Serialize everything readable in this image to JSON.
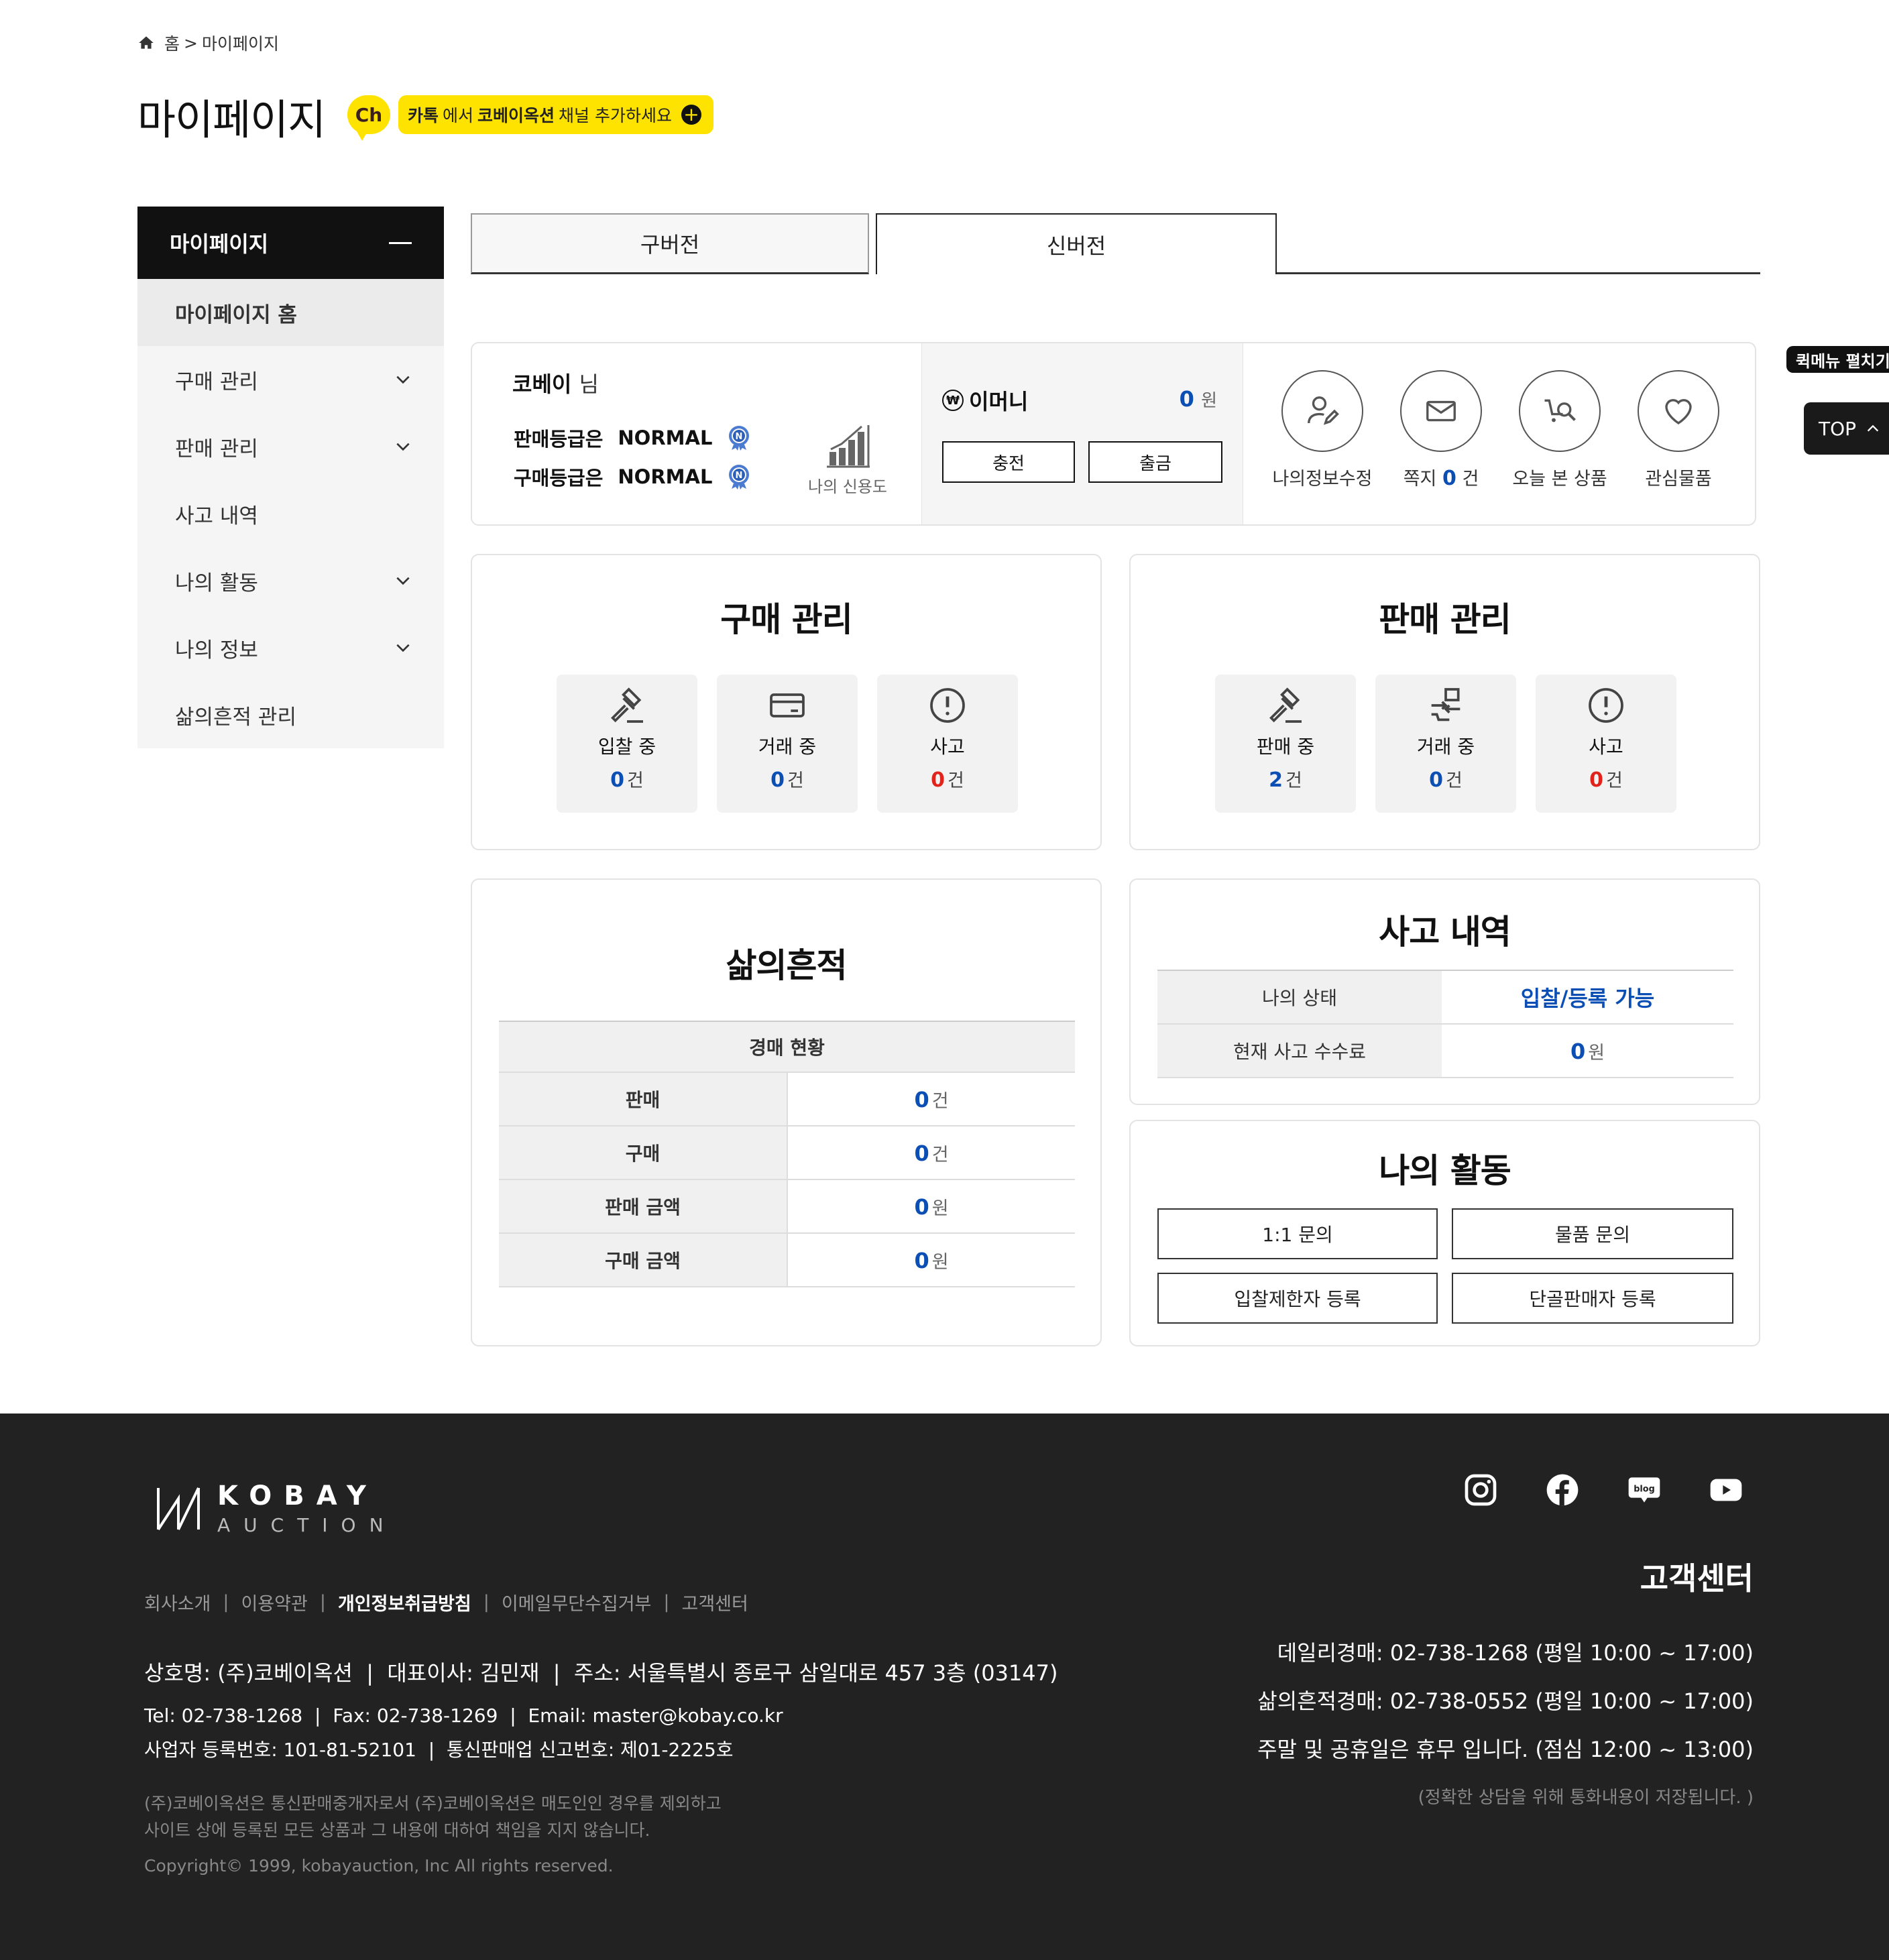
{
  "breadcrumb": {
    "home": "홈",
    "separator": ">",
    "current": "마이페이지"
  },
  "page_title": "마이페이지",
  "kakao": {
    "ch_badge": "Ch",
    "strong1": "카톡",
    "text1": "에서 ",
    "strong2": "코베이옥션",
    "text2": " 채널 추가하세요"
  },
  "sidebar": {
    "header": "마이페이지",
    "items": [
      {
        "label": "마이페이지 홈"
      },
      {
        "label": "구매 관리"
      },
      {
        "label": "판매 관리"
      },
      {
        "label": "사고 내역"
      },
      {
        "label": "나의 활동"
      },
      {
        "label": "나의 정보"
      },
      {
        "label": "삶의흔적 관리"
      }
    ]
  },
  "tabs": {
    "old": "구버전",
    "new": "신버전"
  },
  "profile": {
    "name": "코베이",
    "suffix": "님",
    "sell_grade_label": "판매등급은",
    "sell_grade": "NORMAL",
    "buy_grade_label": "구매등급은",
    "buy_grade": "NORMAL",
    "grade_badge": "N",
    "credit_label": "나의 신용도",
    "emoney_symbol": "₩",
    "emoney_label": "이머니",
    "emoney_value": "0",
    "emoney_unit": "원",
    "charge": "충전",
    "withdraw": "출금",
    "quick": {
      "edit_info": "나의정보수정",
      "message_label": "쪽지",
      "message_count": "0",
      "message_unit": "건",
      "recent": "오늘 본 상품",
      "wishlist": "관심물품"
    }
  },
  "purchase": {
    "title": "구매 관리",
    "tiles": [
      {
        "label": "입찰 중",
        "value": "0",
        "unit": "건"
      },
      {
        "label": "거래 중",
        "value": "0",
        "unit": "건"
      },
      {
        "label": "사고",
        "value": "0",
        "unit": "건"
      }
    ]
  },
  "sales": {
    "title": "판매 관리",
    "tiles": [
      {
        "label": "판매 중",
        "value": "2",
        "unit": "건"
      },
      {
        "label": "거래 중",
        "value": "0",
        "unit": "건"
      },
      {
        "label": "사고",
        "value": "0",
        "unit": "건"
      }
    ]
  },
  "life": {
    "title": "삶의흔적",
    "table_header": "경매 현황",
    "rows": [
      {
        "label": "판매",
        "value": "0",
        "unit": "건"
      },
      {
        "label": "구매",
        "value": "0",
        "unit": "건"
      },
      {
        "label": "판매 금액",
        "value": "0",
        "unit": "원"
      },
      {
        "label": "구매 금액",
        "value": "0",
        "unit": "원"
      }
    ]
  },
  "incident": {
    "title": "사고 내역",
    "status_label": "나의 상태",
    "status_value": "입찰/등록 가능",
    "fee_label": "현재 사고 수수료",
    "fee_value": "0",
    "fee_unit": "원"
  },
  "activity": {
    "title": "나의 활동",
    "buttons": [
      "1:1 문의",
      "물품 문의",
      "입찰제한자 등록",
      "단골판매자 등록"
    ]
  },
  "floating": {
    "quick_menu": "퀵메뉴 펼치기",
    "top": "TOP"
  },
  "footer": {
    "logo_top": "KOBAY",
    "logo_bottom": "AUCTION",
    "nav": [
      "회사소개",
      "이용약관",
      "개인정보취급방침",
      "이메일무단수집거부",
      "고객센터"
    ],
    "company": "상호명: (주)코베이옥션",
    "ceo": "대표이사: 김민재",
    "address": "주소: 서울특별시 종로구 삼일대로 457 3층 (03147)",
    "tel": "Tel: 02-738-1268",
    "fax": "Fax: 02-738-1269",
    "email": "Email: master@kobay.co.kr",
    "biz_no": "사업자 등록번호: 101-81-52101",
    "ecom_no": "통신판매업 신고번호: 제01-2225호",
    "note1": "(주)코베이옥션은 통신판매중개자로서 (주)코베이옥션은 매도인인 경우를 제외하고",
    "note2": "사이트 상에 등록된 모든 상품과 그 내용에 대하여 책임을 지지 않습니다.",
    "copyright": "Copyright© 1999, kobayauction, Inc All rights reserved.",
    "cs_title": "고객센터",
    "cs_daily": "데일리경매: 02-738-1268 (평일 10:00 ~ 17:00)",
    "cs_life": "삶의흔적경매: 02-738-0552 (평일 10:00 ~ 17:00)",
    "cs_weekend": "주말 및 공휴일은 휴무 입니다. (점심 12:00 ~ 13:00)",
    "cs_note": "(정확한 상담을 위해 통화내용이 저장됩니다. )",
    "social_blog": "blog"
  }
}
